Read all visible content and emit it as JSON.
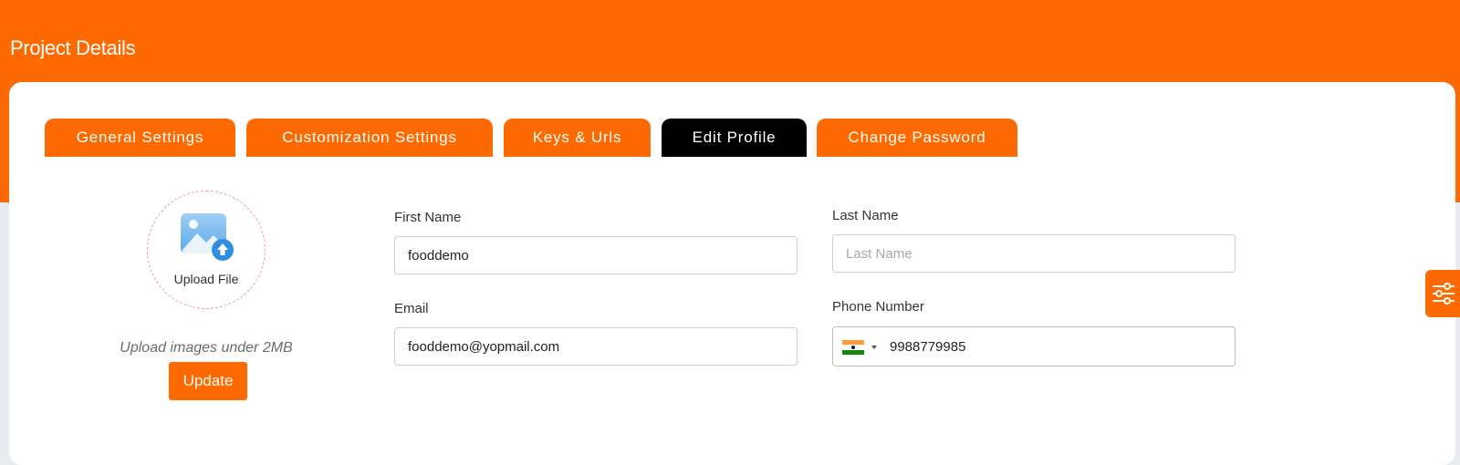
{
  "header": {
    "title": "Project Details"
  },
  "tabs": [
    {
      "label": "General Settings",
      "active": false
    },
    {
      "label": "Customization Settings",
      "active": false
    },
    {
      "label": "Keys & Urls",
      "active": false
    },
    {
      "label": "Edit Profile",
      "active": true
    },
    {
      "label": "Change Password",
      "active": false
    }
  ],
  "upload": {
    "label": "Upload File",
    "hint": "Upload images under 2MB",
    "icon": "image-upload-icon"
  },
  "update_button": {
    "label": "Update"
  },
  "form": {
    "first_name": {
      "label": "First Name",
      "value": "fooddemo",
      "placeholder": ""
    },
    "last_name": {
      "label": "Last Name",
      "value": "",
      "placeholder": "Last Name"
    },
    "email": {
      "label": "Email",
      "value": "fooddemo@yopmail.com",
      "placeholder": ""
    },
    "phone": {
      "label": "Phone Number",
      "value": "9988779985",
      "country_flag": "india-flag-icon"
    }
  },
  "colors": {
    "brand": "#ff6a00",
    "active_tab": "#000000",
    "page_bg": "#e8ebf0"
  },
  "side_widget": {
    "icon": "sliders-icon"
  }
}
